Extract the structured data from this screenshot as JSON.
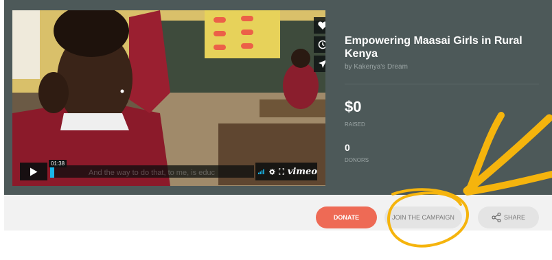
{
  "video": {
    "elapsed": "01:38",
    "subtitle": "And the way to do that, to me, is educ",
    "brand": "vimeo"
  },
  "campaign": {
    "title": "Empowering Maasai Girls in Rural Kenya",
    "organizer": "by Kakenya's Dream",
    "raised_amount": "$0",
    "raised_label": "RAISED",
    "donor_count": "0",
    "donors_label": "DONORS"
  },
  "actions": {
    "donate": "DONATE",
    "join": "JOIN THE CAMPAIGN",
    "share": "SHARE"
  },
  "colors": {
    "panel": "#4d5959",
    "donate": "#ee6a55",
    "annotation": "#f5b40d",
    "vimeo_accent": "#1ab7ea"
  }
}
